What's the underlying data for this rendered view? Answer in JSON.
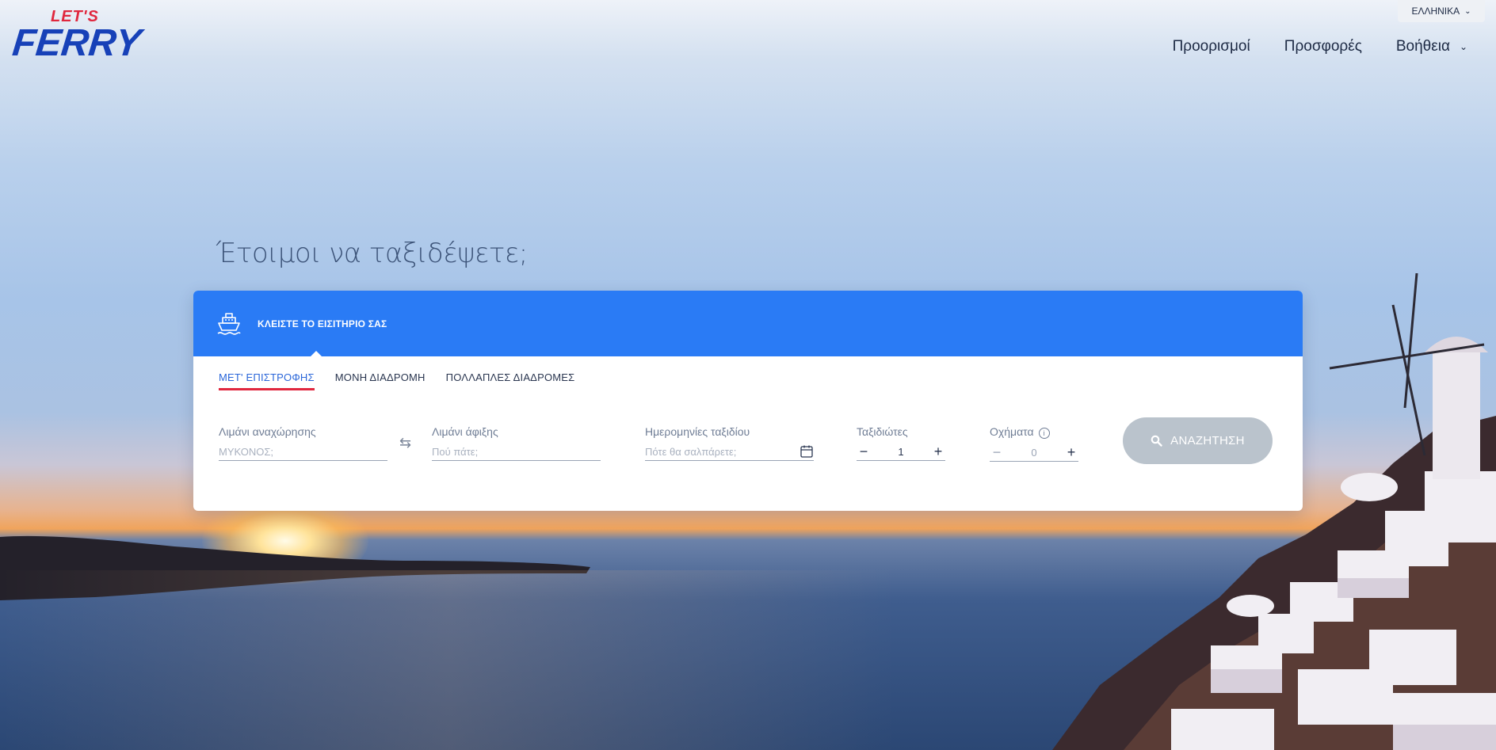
{
  "brand": {
    "logo_top": "LET'S",
    "logo_main": "FERRY"
  },
  "language": {
    "label": "ΕΛΛΗΝΙΚΑ"
  },
  "nav": {
    "destinations": "Προορισμοί",
    "offers": "Προσφορές",
    "help": "Βοήθεια"
  },
  "hero": {
    "title": "Έτοιμοι να ταξιδέψετε;"
  },
  "booking": {
    "header": "ΚΛΕΙΣΤΕ ΤΟ ΕΙΣΙΤΗΡΙΟ ΣΑΣ",
    "tabs": [
      {
        "label": "ΜΕΤ' ΕΠΙΣΤΡΟΦΗΣ",
        "active": true
      },
      {
        "label": "ΜΟΝΗ ΔΙΑΔΡΟΜΗ",
        "active": false
      },
      {
        "label": "ΠΟΛΛΑΠΛΕΣ ΔΙΑΔΡΟΜΕΣ",
        "active": false
      }
    ],
    "departure": {
      "label": "Λιμάνι αναχώρησης",
      "placeholder": "ΜΥΚΟΝΟΣ;",
      "value": ""
    },
    "arrival": {
      "label": "Λιμάνι άφιξης",
      "placeholder": "Πού πάτε;",
      "value": ""
    },
    "dates": {
      "label": "Ημερομηνίες ταξιδίου",
      "placeholder": "Πότε θα σαλπάρετε;",
      "value": ""
    },
    "travelers": {
      "label": "Ταξιδιώτες",
      "value": "1"
    },
    "vehicles": {
      "label": "Οχήματα",
      "value": "0"
    },
    "search_label": "ΑΝΑΖΗΤΗΣΗ"
  },
  "colors": {
    "primary": "#2a7bf5",
    "accent": "#e0273e",
    "brand": "#1741b8",
    "search_disabled": "#bac3cc"
  },
  "icons": [
    "ship-icon",
    "swap-icon",
    "calendar-icon",
    "search-icon",
    "info-icon",
    "chevron-down-icon"
  ]
}
